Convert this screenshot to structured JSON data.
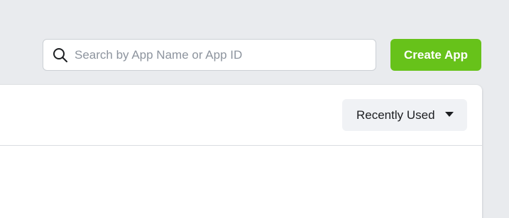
{
  "search": {
    "placeholder": "Search by App Name or App ID",
    "icon": "search-icon"
  },
  "toolbar": {
    "create_label": "Create App"
  },
  "panel": {
    "sort": {
      "label": "Recently Used",
      "icon": "caret-down-icon"
    }
  },
  "colors": {
    "background": "#e9ebee",
    "accent": "#67c21a",
    "panel": "#ffffff",
    "dropdown": "#f0f2f5"
  }
}
